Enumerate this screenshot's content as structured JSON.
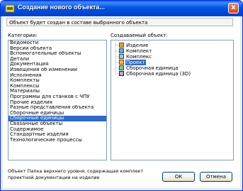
{
  "window": {
    "title": "Создание нового объекта...",
    "close_label": "x"
  },
  "description": "Объект будет создан в составе выбранного объекта",
  "categories": {
    "label": "Категории:",
    "items": [
      "Ведомости",
      "Версии объекта",
      "Вспомогательные объекты",
      "Детали",
      "Документация",
      "Извещения об изменении",
      "Исполнения",
      "Комплекты",
      "Комплексы",
      "Материалы",
      "Программы для станков с ЧПУ",
      "Прочие изделия",
      "Разные представления объекта",
      "Сборочные единицы",
      "Сборочные единицы",
      "Связанные объекты",
      "Содержимое",
      "Стандартные изделия",
      "Технологические процессы"
    ],
    "selected_index": 14
  },
  "objects": {
    "label": "Создаваемый объект:",
    "items": [
      {
        "label": "Изделие",
        "icon": "product-icon"
      },
      {
        "label": "Комплект",
        "icon": "kit-icon"
      },
      {
        "label": "Комплекс",
        "icon": "complex-icon"
      },
      {
        "label": "Проект",
        "icon": "project-icon"
      },
      {
        "label": "Сборочная единица",
        "icon": "assembly-icon"
      },
      {
        "label": "Сборочная единица (3D)",
        "icon": "assembly-3d-icon"
      }
    ],
    "selected_index": 3
  },
  "bottom_description": "Объект    Папка верхнего уровня, содержащая комплект проектной документации на изделие",
  "buttons": {
    "ok": "ОК",
    "cancel": "Отмена"
  },
  "colors": {
    "title_bar": "#0055e5",
    "selection": "#316ac5"
  }
}
